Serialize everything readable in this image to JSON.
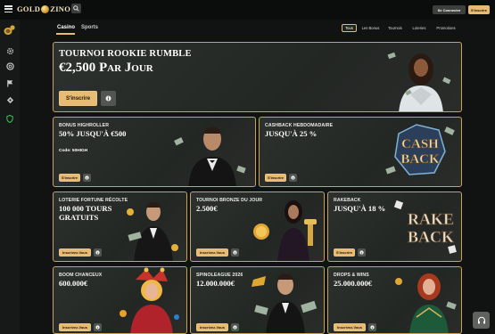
{
  "header": {
    "logo_text_left": "GOLD",
    "logo_text_right": "ZINO",
    "login_label": "Se Connecter",
    "signup_label": "S'inscrire"
  },
  "tabs": [
    {
      "label": "Casino",
      "active": true
    },
    {
      "label": "Sports",
      "active": false
    }
  ],
  "filters": [
    {
      "label": "Tous",
      "active": true
    },
    {
      "label": "Les Bonus",
      "active": false
    },
    {
      "label": "Tournois",
      "active": false
    },
    {
      "label": "Loteries",
      "active": false
    },
    {
      "label": "Promotions",
      "active": false
    }
  ],
  "sidebar": {
    "icons": [
      "coin-stack-icon",
      "settings-gear-icon",
      "chip-icon",
      "flag-icon",
      "puzzle-icon",
      "shield-icon"
    ]
  },
  "hero": {
    "title": "Tournoi Rookie Rumble",
    "headline": "€2,500 Par Jour",
    "cta": "S'inscrire"
  },
  "cards_row1": [
    {
      "title": "Bonus Highroller",
      "headline": "50% jusqu'à €500",
      "code": "Code: 50HIGH",
      "cta": "S'inscrire"
    },
    {
      "title": "Cashback Hebdomadaire",
      "headline": "jusqu'à 25 %",
      "cta": "S'inscrire",
      "art_line1": "CASH",
      "art_line2": "BACK"
    }
  ],
  "cards_row2": [
    {
      "title": "Loterie Fortune Récolte",
      "headline": "100 000 Tours Gratuits",
      "cta": "Inscrivez-Vous"
    },
    {
      "title": "Tournoi Bronze du Jour",
      "headline": "2.500€",
      "cta": "Inscrivez-Vous"
    },
    {
      "title": "Rakeback",
      "headline": "jusqu'à 18 %",
      "cta": "S'inscrire",
      "art_line1": "RAKE",
      "art_line2": "BACK"
    }
  ],
  "cards_row3": [
    {
      "title": "Boom Chanceux",
      "headline": "600.000€",
      "cta": "Inscrivez-Vous"
    },
    {
      "title": "Spinoleague 2026",
      "headline": "12.000.000€",
      "cta": "Inscrivez-Vous"
    },
    {
      "title": "Drops & Wins",
      "headline": "25.000.000€",
      "cta": "Inscrivez-Vous"
    }
  ],
  "colors": {
    "accent": "#e7bb74",
    "border": "#c9a25c",
    "bg": "#101311"
  }
}
